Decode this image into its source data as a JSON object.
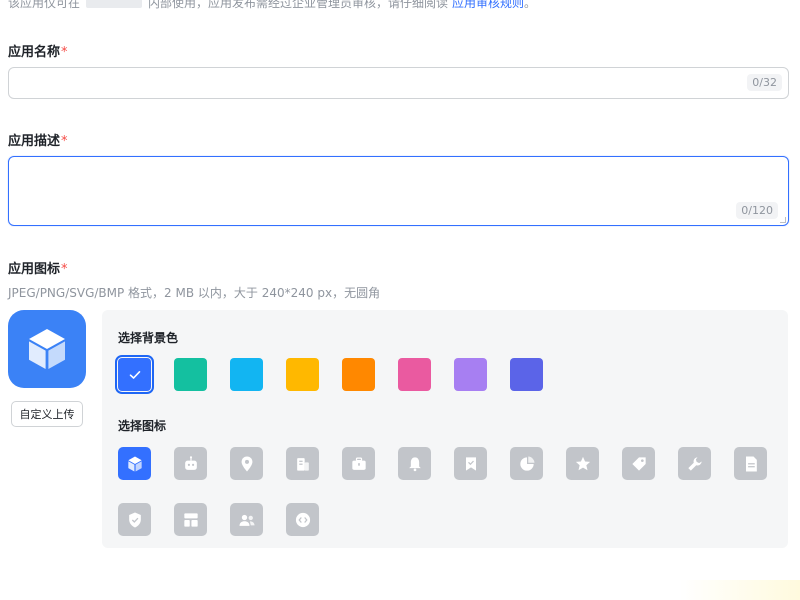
{
  "notice": {
    "prefix": "该应用仅可在",
    "middle": "内部使用，应用发布需经过企业管理员审核，请仔细阅读",
    "link": "应用审核规则",
    "suffix": "。"
  },
  "form": {
    "name": {
      "label": "应用名称",
      "required_mark": "*",
      "counter": "0/32",
      "value": ""
    },
    "description": {
      "label": "应用描述",
      "required_mark": "*",
      "counter": "0/120",
      "value": ""
    },
    "icon": {
      "label": "应用图标",
      "required_mark": "*",
      "hint": "JPEG/PNG/SVG/BMP 格式，2 MB 以内，大于 240*240 px，无圆角",
      "upload_label": "自定义上传",
      "preview_icon": "cube-icon"
    }
  },
  "picker": {
    "bg_title": "选择背景色",
    "icon_title": "选择图标",
    "colors": [
      {
        "hex": "#3370ff",
        "selected": true
      },
      {
        "hex": "#14c0a0",
        "selected": false
      },
      {
        "hex": "#12b5f2",
        "selected": false
      },
      {
        "hex": "#ffb800",
        "selected": false
      },
      {
        "hex": "#ff8800",
        "selected": false
      },
      {
        "hex": "#ea5aa0",
        "selected": false
      },
      {
        "hex": "#a77ff2",
        "selected": false
      },
      {
        "hex": "#5b64e8",
        "selected": false
      }
    ],
    "icons": [
      {
        "name": "cube-icon",
        "selected": true
      },
      {
        "name": "robot-icon",
        "selected": false
      },
      {
        "name": "location-pin-icon",
        "selected": false
      },
      {
        "name": "building-icon",
        "selected": false
      },
      {
        "name": "briefcase-icon",
        "selected": false
      },
      {
        "name": "bell-icon",
        "selected": false
      },
      {
        "name": "bookmark-icon",
        "selected": false
      },
      {
        "name": "pie-chart-icon",
        "selected": false
      },
      {
        "name": "star-icon",
        "selected": false
      },
      {
        "name": "tag-icon",
        "selected": false
      },
      {
        "name": "wrench-icon",
        "selected": false
      },
      {
        "name": "document-icon",
        "selected": false
      },
      {
        "name": "shield-check-icon",
        "selected": false
      },
      {
        "name": "layout-icon",
        "selected": false
      },
      {
        "name": "users-icon",
        "selected": false
      },
      {
        "name": "code-icon",
        "selected": false
      }
    ]
  }
}
